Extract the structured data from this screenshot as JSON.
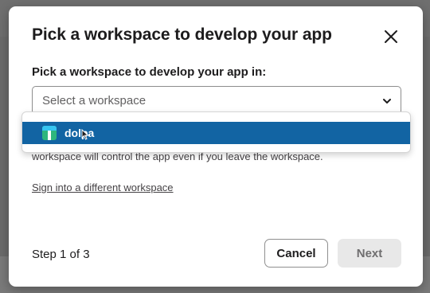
{
  "modal": {
    "title": "Pick a workspace to develop your app",
    "field_label": "Pick a workspace to develop your app in:",
    "select": {
      "placeholder": "Select a workspace"
    },
    "dropdown": {
      "items": [
        {
          "label": "dolpa"
        }
      ]
    },
    "helper_text": "workspace will control the app even if you leave the workspace.",
    "signin_link": "Sign into a different workspace",
    "footer": {
      "step": "Step 1 of 3",
      "cancel_label": "Cancel",
      "next_label": "Next"
    }
  },
  "colors": {
    "accent": "#1264a3",
    "logo_teal": "#2eb67d",
    "logo_blue": "#36c5f0"
  }
}
